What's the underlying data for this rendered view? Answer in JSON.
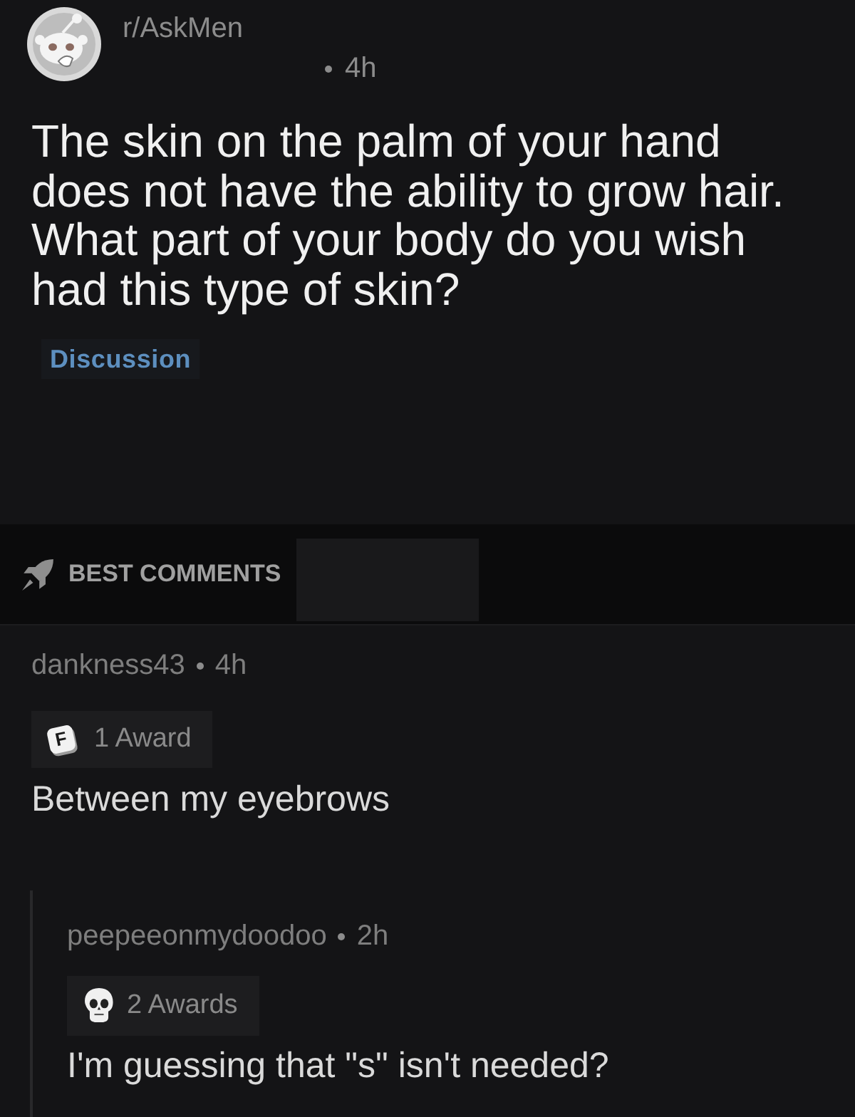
{
  "post": {
    "subreddit": "r/AskMen",
    "time": "4h",
    "title": "The skin on the palm of your hand does not have the ability to grow hair. What part of your body do you wish had this type of skin?",
    "flair": "Discussion"
  },
  "sort": {
    "label": "BEST COMMENTS"
  },
  "comments": [
    {
      "author": "dankness43",
      "time": "4h",
      "award": {
        "kind": "keycap",
        "glyph": "F",
        "label": "1 Award"
      },
      "body": "Between my eyebrows",
      "children": [
        {
          "author": "peepeeonmydoodoo",
          "time": "2h",
          "award": {
            "kind": "skull",
            "label": "2 Awards"
          },
          "body": "I'm guessing that \"s\" isn't needed?"
        }
      ]
    }
  ]
}
